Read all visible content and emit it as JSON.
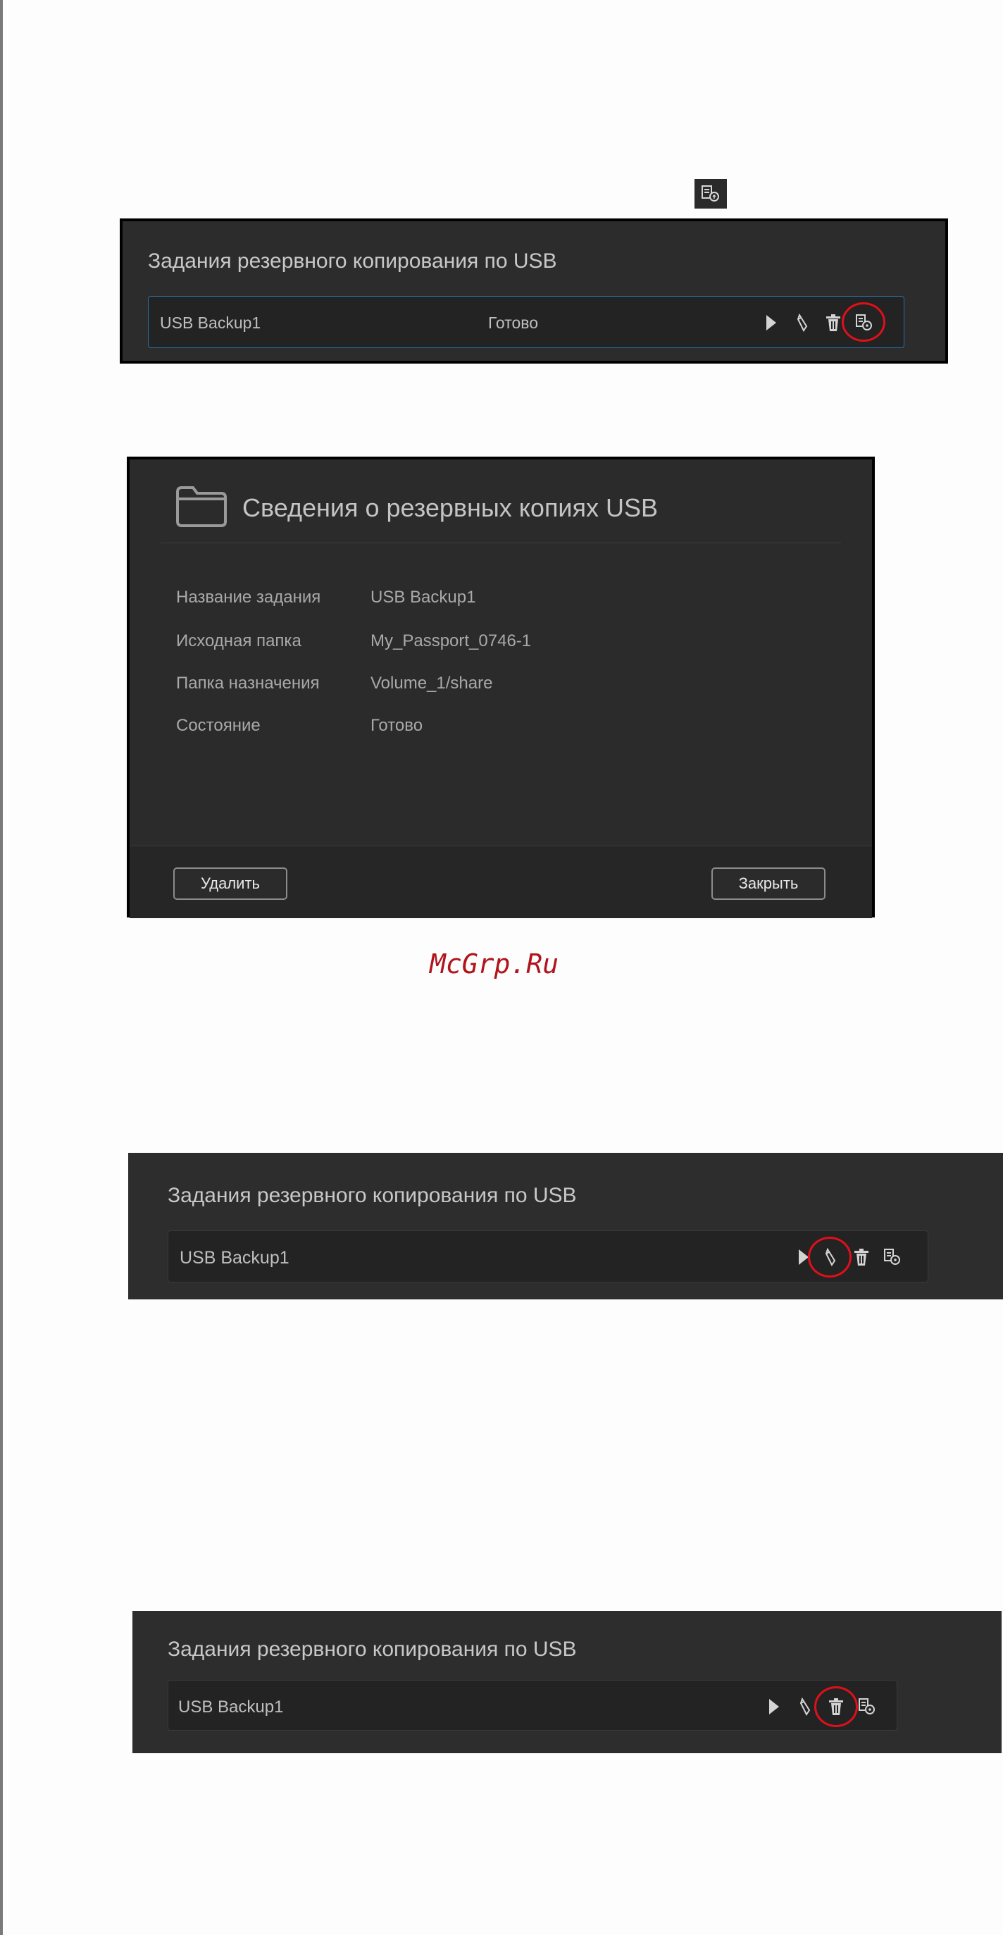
{
  "backup_panel_1": {
    "title": "Задания резервного копирования по USB",
    "job_name": "USB Backup1",
    "job_status": "Готово",
    "highlighted_action": "details-icon"
  },
  "details_dialog": {
    "title": "Сведения о резервных копиях USB",
    "fields": [
      {
        "label": "Название задания",
        "value": "USB Backup1"
      },
      {
        "label": "Исходная папка",
        "value": "My_Passport_0746-1"
      },
      {
        "label": "Папка назначения",
        "value": "Volume_1/share"
      },
      {
        "label": "Состояние",
        "value": "Готово"
      }
    ],
    "delete_label": "Удалить",
    "close_label": "Закрыть"
  },
  "watermark": "McGrp.Ru",
  "backup_panel_2": {
    "title": "Задания резервного копирования по USB",
    "job_name": "USB Backup1",
    "highlighted_action": "edit-icon"
  },
  "backup_panel_3": {
    "title": "Задания резервного копирования по USB",
    "job_name": "USB Backup1",
    "highlighted_action": "delete-icon"
  },
  "colors": {
    "panel_bg": "#2c2c2c",
    "row_bg": "#232323",
    "selected_border": "#2b6fa0",
    "highlight_circle": "#e0101a",
    "watermark": "#b0141c"
  }
}
